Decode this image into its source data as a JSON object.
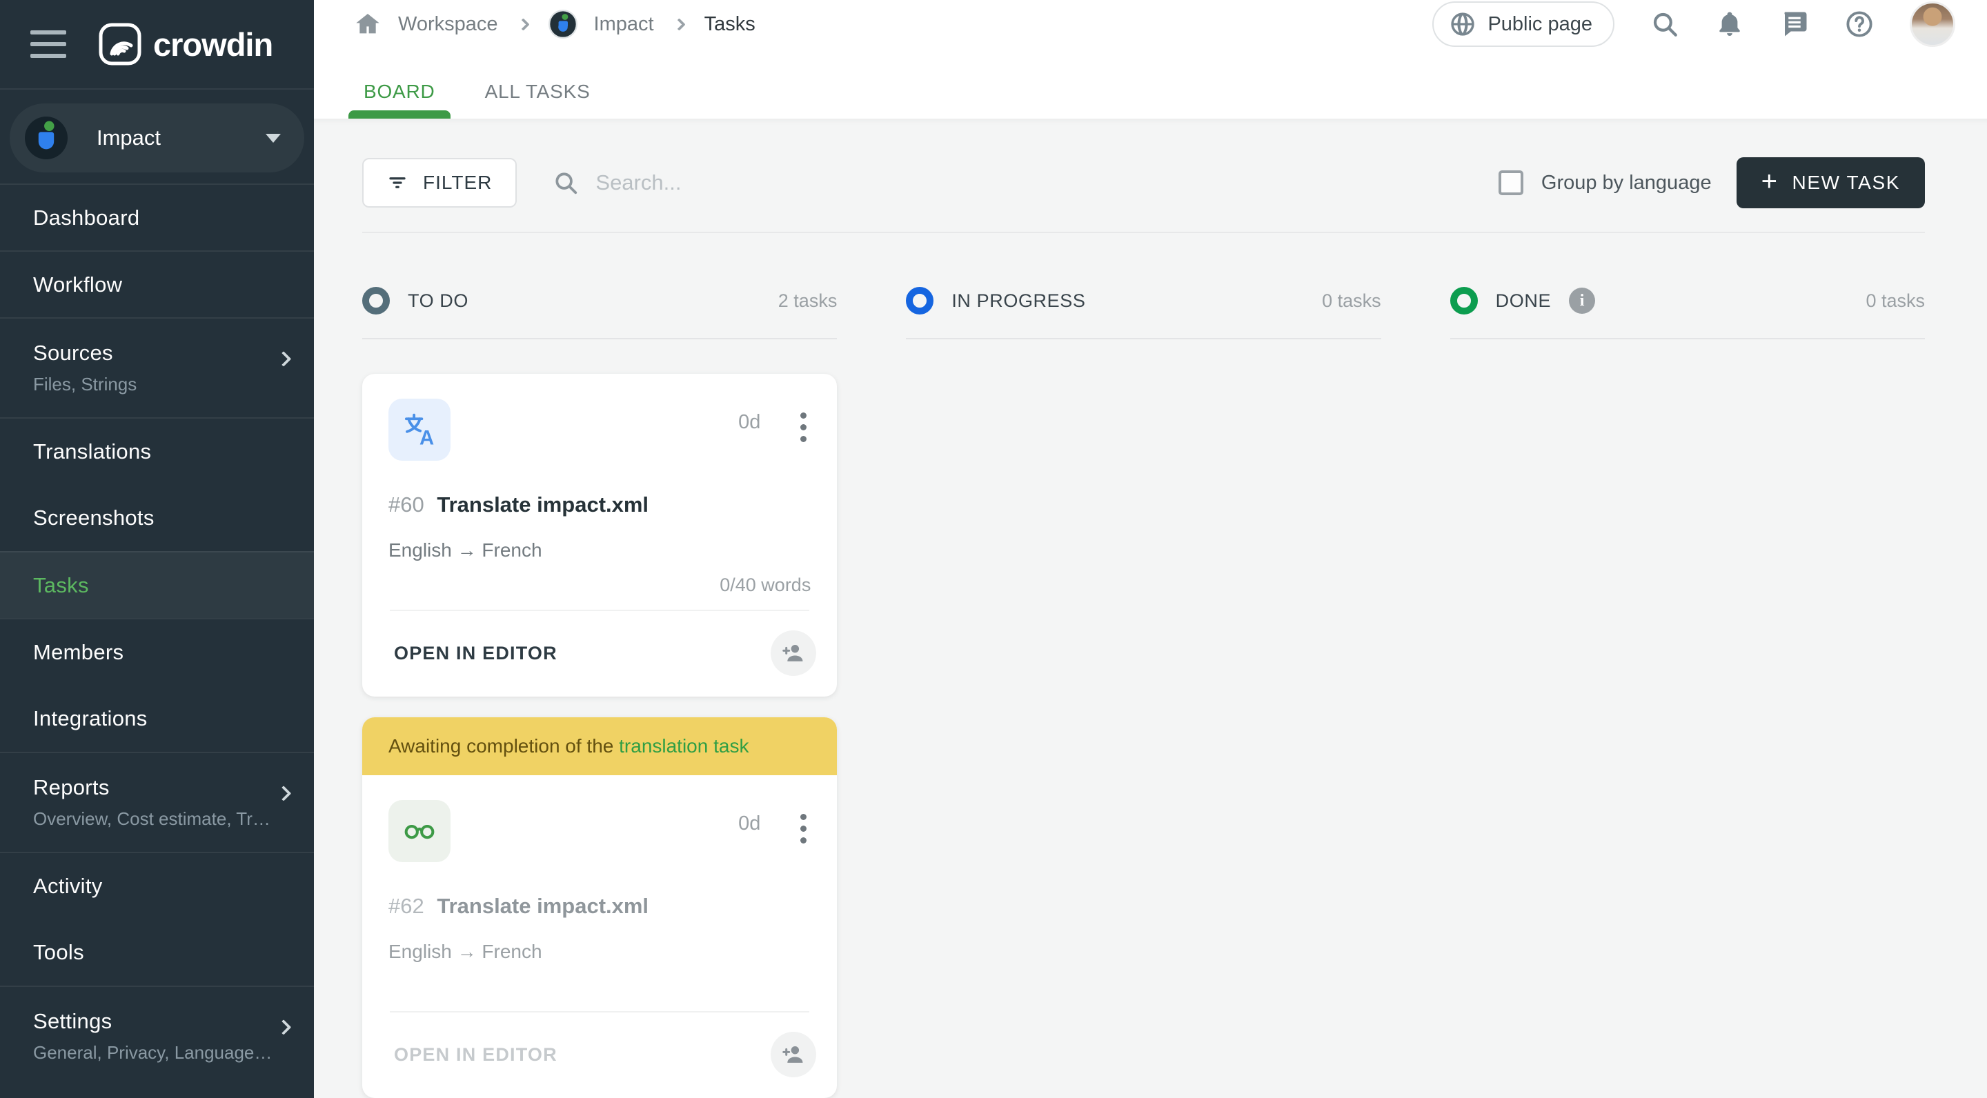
{
  "sidebar": {
    "brand": "crowdin",
    "project": {
      "name": "Impact"
    },
    "items": [
      {
        "label": "Dashboard"
      },
      {
        "label": "Workflow"
      },
      {
        "label": "Sources",
        "subtitle": "Files, Strings"
      },
      {
        "label": "Translations"
      },
      {
        "label": "Screenshots"
      },
      {
        "label": "Tasks"
      },
      {
        "label": "Members"
      },
      {
        "label": "Integrations"
      },
      {
        "label": "Reports",
        "subtitle": "Overview, Cost estimate, Transl…"
      },
      {
        "label": "Activity"
      },
      {
        "label": "Tools"
      },
      {
        "label": "Settings",
        "subtitle": "General, Privacy, Languages, Q…"
      }
    ]
  },
  "header": {
    "breadcrumb": {
      "workspace": "Workspace",
      "project": "Impact",
      "page": "Tasks"
    },
    "public_page_label": "Public page"
  },
  "tabs": {
    "board": "BOARD",
    "all_tasks": "ALL TASKS"
  },
  "toolbar": {
    "filter_label": "FILTER",
    "search_placeholder": "Search...",
    "group_by_label": "Group by language",
    "new_task_label": "NEW TASK",
    "new_task_plus": "+"
  },
  "board": {
    "columns": [
      {
        "title": "TO DO",
        "count": "2 tasks",
        "ring_color": "#546e7a"
      },
      {
        "title": "IN PROGRESS",
        "count": "0 tasks",
        "ring_color": "#1565e0"
      },
      {
        "title": "DONE",
        "count": "0 tasks",
        "ring_color": "#0c9d4f",
        "info": "i"
      }
    ],
    "cards": [
      {
        "id": "#60",
        "title": "Translate impact.xml",
        "languages": "English → French",
        "due": "0d",
        "words": "0/40 words",
        "action": "OPEN IN EDITOR"
      },
      {
        "id": "#62",
        "title": "Translate impact.xml",
        "languages": "English → French",
        "due": "0d",
        "words": "",
        "action": "OPEN IN EDITOR",
        "banner": {
          "text": "Awaiting completion of the ",
          "link": "translation task"
        }
      }
    ]
  }
}
